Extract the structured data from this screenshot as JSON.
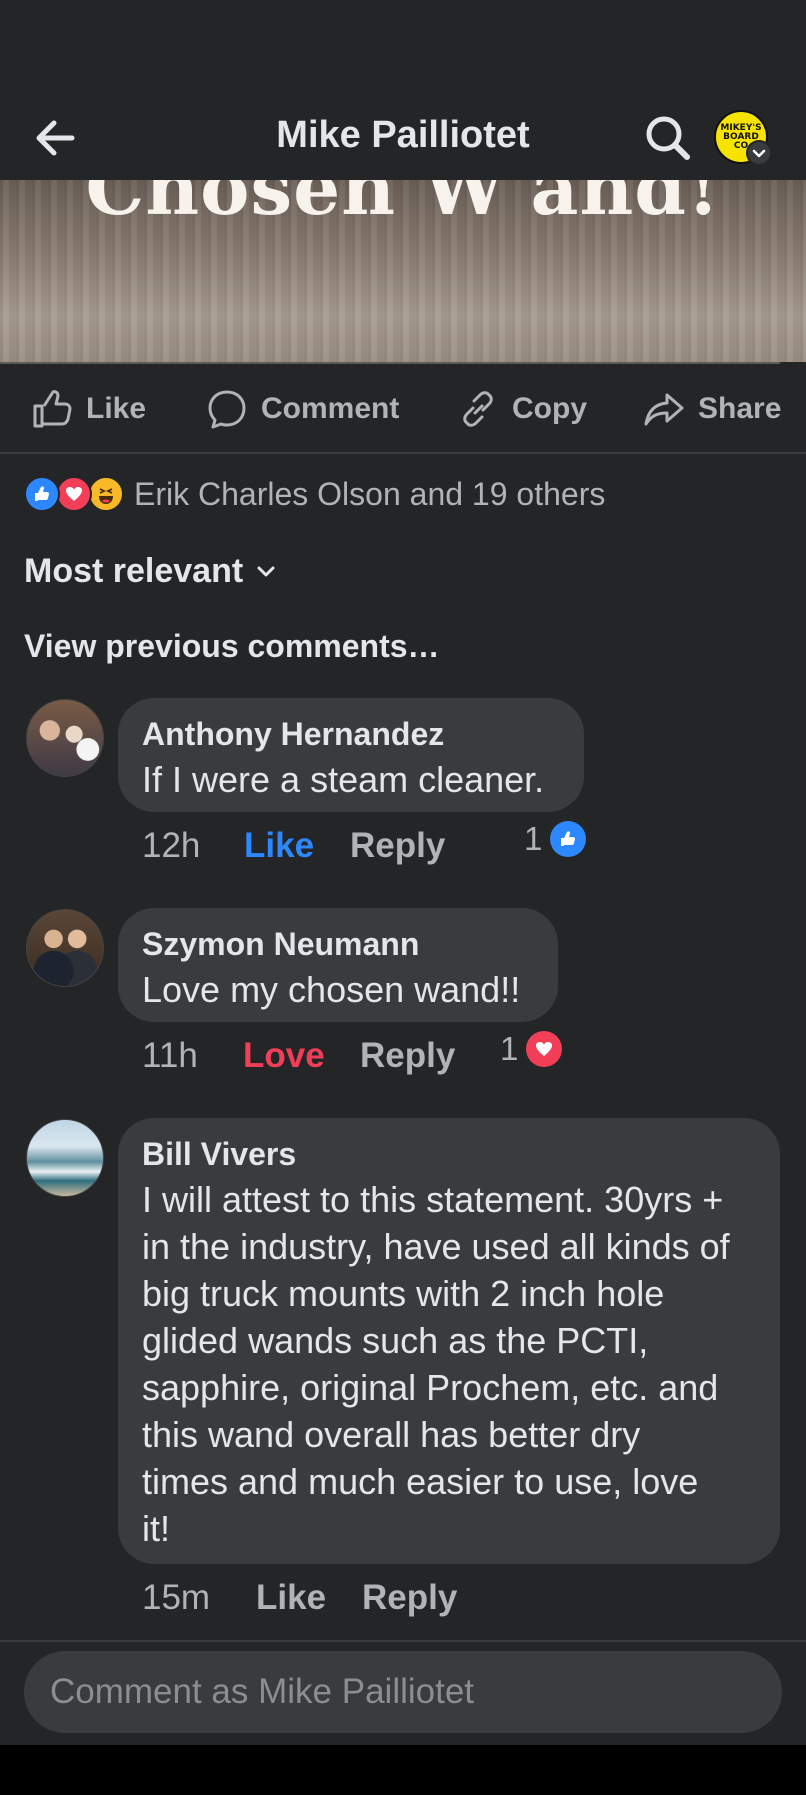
{
  "header": {
    "title": "Mike Pailliotet",
    "profile_avatar_text": "MIKEY'S BOARD CO"
  },
  "post": {
    "image_caption": "Chosen W'and!"
  },
  "actions": {
    "like": "Like",
    "comment": "Comment",
    "copy": "Copy",
    "share": "Share"
  },
  "reactions": {
    "summary": "Erik Charles Olson and 19 others",
    "icons": [
      "like-icon",
      "love-icon",
      "haha-icon"
    ]
  },
  "sort": {
    "label": "Most relevant"
  },
  "view_previous": "View previous comments…",
  "comments": [
    {
      "name": "Anthony Hernandez",
      "text": "If I were a steam cleaner.",
      "time": "12h",
      "reaction_label": "Like",
      "reply": "Reply",
      "reaction_count": "1",
      "reaction_icon": "like-icon"
    },
    {
      "name": "Szymon Neumann",
      "text": "Love my chosen wand!!",
      "time": "11h",
      "reaction_label": "Love",
      "reply": "Reply",
      "reaction_count": "1",
      "reaction_icon": "love-icon"
    },
    {
      "name": "Bill Vivers",
      "text_lines": [
        "I will attest to this statement. 30yrs +",
        "in the industry, have used all kinds of",
        "big truck mounts with 2 inch hole",
        "glided wands such as the PCTI,",
        "sapphire, original Prochem, etc. and",
        "this wand overall has better dry",
        "times and much easier to use, love",
        "it!"
      ],
      "time": "15m",
      "reaction_label": "Like",
      "reply": "Reply"
    }
  ],
  "composer": {
    "placeholder": "Comment as Mike Pailliotet"
  },
  "colors": {
    "background": "#242526",
    "bubble": "#3a3b3c",
    "like_blue": "#2d88ff",
    "love_red": "#f33e58",
    "muted_text": "#b0b3b8"
  }
}
